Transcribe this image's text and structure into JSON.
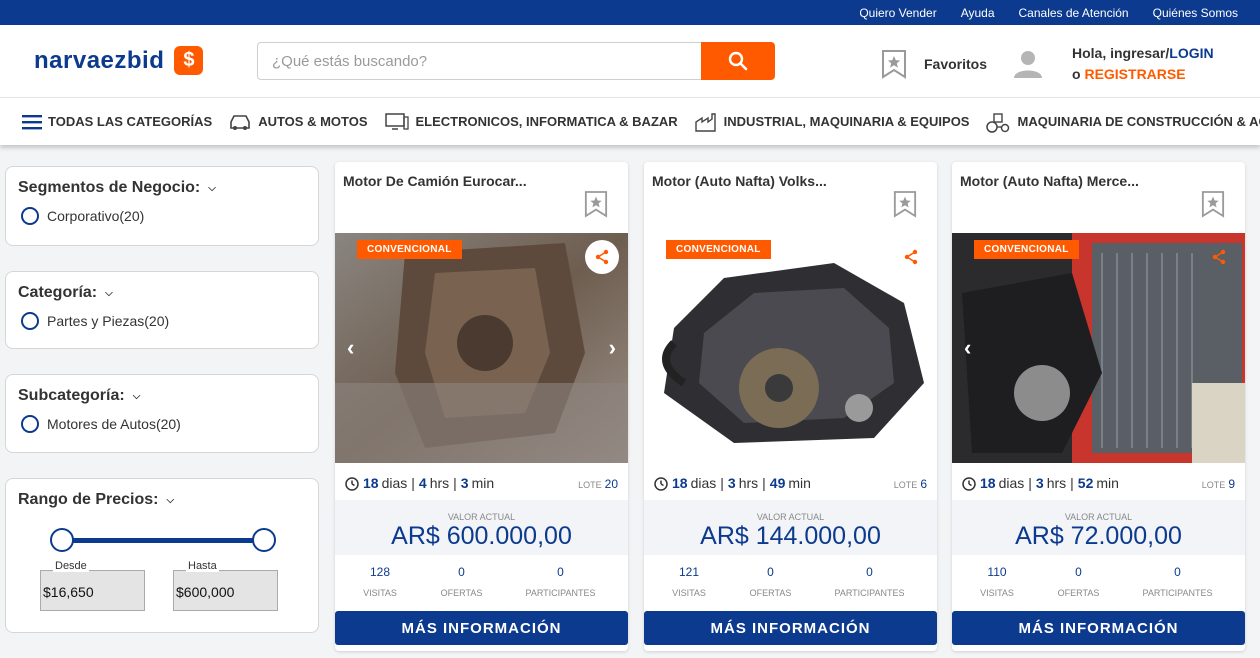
{
  "topbar": {
    "links": [
      "Quiero Vender",
      "Ayuda",
      "Canales de Atención",
      "Quiénes Somos"
    ]
  },
  "header": {
    "logo_text": "narvaezbid",
    "logo_badge": "$",
    "search_placeholder": "¿Qué estás buscando?",
    "favorites_label": "Favoritos",
    "greeting": "Hola, ingresar/",
    "login": "LOGIN",
    "or": "o ",
    "register": "REGISTRARSE"
  },
  "categories": [
    {
      "label": "TODAS LAS CATEGORÍAS",
      "icon": "menu-icon"
    },
    {
      "label": "AUTOS & MOTOS",
      "icon": "car-icon"
    },
    {
      "label": "ELECTRONICOS, INFORMATICA & BAZAR",
      "icon": "computer-icon"
    },
    {
      "label": "INDUSTRIAL, MAQUINARIA & EQUIPOS",
      "icon": "factory-icon"
    },
    {
      "label": "MAQUINARIA DE CONSTRUCCIÓN & AGRÍCOLA",
      "icon": "tractor-icon"
    }
  ],
  "filters": {
    "segmentos": {
      "title": "Segmentos de Negocio:",
      "option": "Corporativo(20)"
    },
    "categoria": {
      "title": "Categoría:",
      "option": "Partes y Piezas(20)"
    },
    "subcategoria": {
      "title": "Subcategoría:",
      "option": "Motores de Autos(20)"
    },
    "precio": {
      "title": "Rango de Precios:",
      "desde_label": "Desde",
      "desde": "$16,650",
      "hasta_label": "Hasta",
      "hasta": "$600,000"
    }
  },
  "cards": [
    {
      "title": "Motor De Camión Eurocar...",
      "badge": "CONVENCIONAL",
      "days": "18",
      "days_unit": "dias",
      "hrs": "4",
      "hrs_unit": "hrs",
      "min": "3",
      "min_unit": "min",
      "lote_label": "LOTE",
      "lote": "20",
      "value_label": "VALOR ACTUAL",
      "value": "AR$ 600.000,00",
      "visitas": "128",
      "visitas_label": "VISITAS",
      "ofertas": "0",
      "ofertas_label": "OFERTAS",
      "participantes": "0",
      "participantes_label": "PARTICIPANTES",
      "button": "MÁS INFORMACIÓN"
    },
    {
      "title": "Motor (Auto Nafta) Volks...",
      "badge": "CONVENCIONAL",
      "days": "18",
      "days_unit": "dias",
      "hrs": "3",
      "hrs_unit": "hrs",
      "min": "49",
      "min_unit": "min",
      "lote_label": "LOTE",
      "lote": "6",
      "value_label": "VALOR ACTUAL",
      "value": "AR$ 144.000,00",
      "visitas": "121",
      "visitas_label": "VISITAS",
      "ofertas": "0",
      "ofertas_label": "OFERTAS",
      "participantes": "0",
      "participantes_label": "PARTICIPANTES",
      "button": "MÁS INFORMACIÓN"
    },
    {
      "title": "Motor (Auto Nafta) Merce...",
      "badge": "CONVENCIONAL",
      "days": "18",
      "days_unit": "dias",
      "hrs": "3",
      "hrs_unit": "hrs",
      "min": "52",
      "min_unit": "min",
      "lote_label": "LOTE",
      "lote": "9",
      "value_label": "VALOR ACTUAL",
      "value": "AR$ 72.000,00",
      "visitas": "110",
      "visitas_label": "VISITAS",
      "ofertas": "0",
      "ofertas_label": "OFERTAS",
      "participantes": "0",
      "participantes_label": "PARTICIPANTES",
      "button": "MÁS INFORMACIÓN"
    }
  ],
  "colors": {
    "brand_blue": "#0c3a8e",
    "accent_orange": "#ff5a00"
  }
}
